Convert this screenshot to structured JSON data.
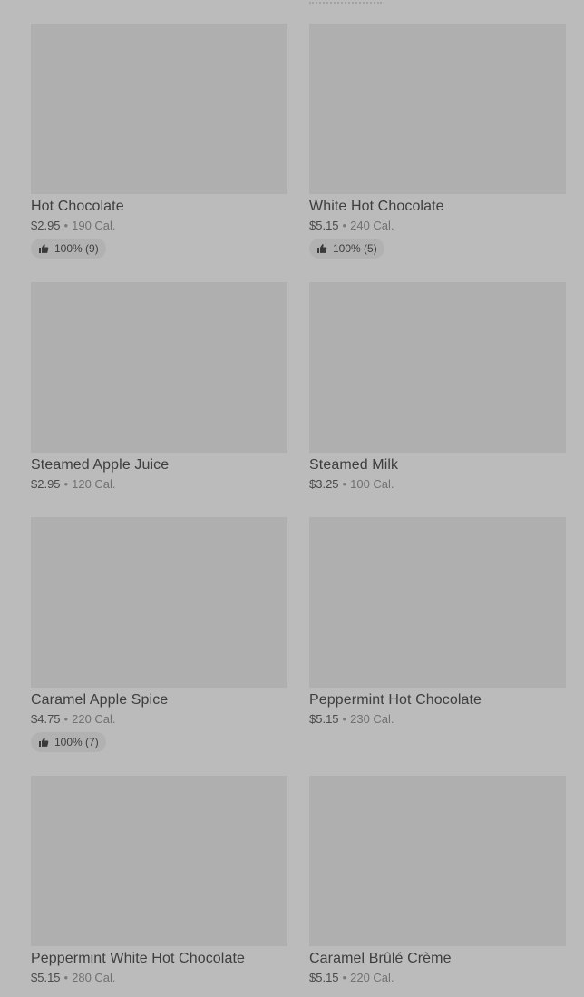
{
  "menu": {
    "items": [
      {
        "name": "Hot Chocolate",
        "price": "$2.95",
        "calories": "190 Cal.",
        "rating": "100% (9)"
      },
      {
        "name": "White Hot Chocolate",
        "price": "$5.15",
        "calories": "240 Cal.",
        "rating": "100% (5)"
      },
      {
        "name": "Steamed Apple Juice",
        "price": "$2.95",
        "calories": "120 Cal.",
        "rating": null
      },
      {
        "name": "Steamed Milk",
        "price": "$3.25",
        "calories": "100 Cal.",
        "rating": null
      },
      {
        "name": "Caramel Apple Spice",
        "price": "$4.75",
        "calories": "220 Cal.",
        "rating": "100% (7)"
      },
      {
        "name": "Peppermint Hot Chocolate",
        "price": "$5.15",
        "calories": "230 Cal.",
        "rating": null
      },
      {
        "name": "Peppermint White Hot Chocolate",
        "price": "$5.15",
        "calories": "280 Cal.",
        "rating": null
      },
      {
        "name": "Caramel Brûlé Crème",
        "price": "$5.15",
        "calories": "220 Cal.",
        "rating": null
      }
    ],
    "separator": "•",
    "icons": {
      "rating": "thumbs-up-icon"
    }
  }
}
